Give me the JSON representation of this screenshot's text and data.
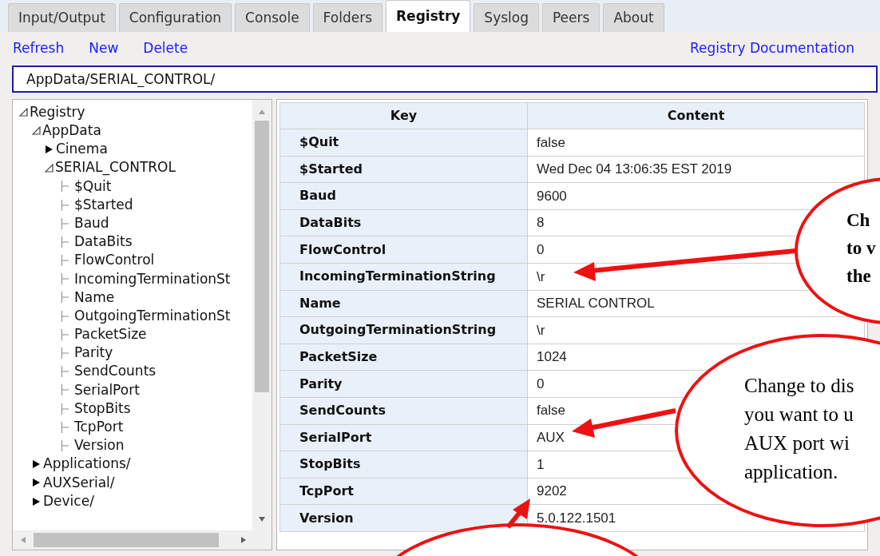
{
  "tabs": [
    {
      "label": "Input/Output",
      "selected": false
    },
    {
      "label": "Configuration",
      "selected": false
    },
    {
      "label": "Console",
      "selected": false
    },
    {
      "label": "Folders",
      "selected": false
    },
    {
      "label": "Registry",
      "selected": true
    },
    {
      "label": "Syslog",
      "selected": false
    },
    {
      "label": "Peers",
      "selected": false
    },
    {
      "label": "About",
      "selected": false
    }
  ],
  "toolbar": {
    "actions": [
      "Refresh",
      "New",
      "Delete"
    ],
    "documentation_link": "Registry Documentation"
  },
  "path_field": {
    "value": "AppData/SERIAL_CONTROL/"
  },
  "tree": [
    {
      "label": "Registry",
      "kind": "folder",
      "expanded": true,
      "children": [
        {
          "label": "AppData",
          "kind": "folder",
          "expanded": true,
          "children": [
            {
              "label": "Cinema",
              "kind": "folder",
              "expanded": false
            },
            {
              "label": "SERIAL_CONTROL",
              "kind": "folder",
              "expanded": true,
              "children": [
                {
                  "label": "$Quit",
                  "kind": "leaf"
                },
                {
                  "label": "$Started",
                  "kind": "leaf"
                },
                {
                  "label": "Baud",
                  "kind": "leaf"
                },
                {
                  "label": "DataBits",
                  "kind": "leaf"
                },
                {
                  "label": "FlowControl",
                  "kind": "leaf"
                },
                {
                  "label": "IncomingTerminationSt",
                  "kind": "leaf"
                },
                {
                  "label": "Name",
                  "kind": "leaf"
                },
                {
                  "label": "OutgoingTerminationSt",
                  "kind": "leaf"
                },
                {
                  "label": "PacketSize",
                  "kind": "leaf"
                },
                {
                  "label": "Parity",
                  "kind": "leaf"
                },
                {
                  "label": "SendCounts",
                  "kind": "leaf"
                },
                {
                  "label": "SerialPort",
                  "kind": "leaf"
                },
                {
                  "label": "StopBits",
                  "kind": "leaf"
                },
                {
                  "label": "TcpPort",
                  "kind": "leaf"
                },
                {
                  "label": "Version",
                  "kind": "leaf"
                }
              ]
            }
          ]
        },
        {
          "label": "Applications/",
          "kind": "folder",
          "expanded": false
        },
        {
          "label": "AUXSerial/",
          "kind": "folder",
          "expanded": false
        },
        {
          "label": "Device/",
          "kind": "folder",
          "expanded": false
        }
      ]
    }
  ],
  "table": {
    "columns": [
      "Key",
      "Content"
    ],
    "rows": [
      [
        "$Quit",
        "false"
      ],
      [
        "$Started",
        "Wed Dec 04 13:06:35 EST 2019"
      ],
      [
        "Baud",
        "9600"
      ],
      [
        "DataBits",
        "8"
      ],
      [
        "FlowControl",
        "0"
      ],
      [
        "IncomingTerminationString",
        "\\r"
      ],
      [
        "Name",
        "SERIAL CONTROL"
      ],
      [
        "OutgoingTerminationString",
        "\\r"
      ],
      [
        "PacketSize",
        "1024"
      ],
      [
        "Parity",
        "0"
      ],
      [
        "SendCounts",
        "false"
      ],
      [
        "SerialPort",
        "AUX"
      ],
      [
        "StopBits",
        "1"
      ],
      [
        "TcpPort",
        "9202"
      ],
      [
        "Version",
        "5.0.122.1501"
      ]
    ]
  },
  "callouts": [
    {
      "bold": true,
      "lines": [
        "Ch",
        "to v",
        "the"
      ]
    },
    {
      "bold": false,
      "lines": [
        "Change to dis",
        "you want to u",
        "AUX port wi",
        "application."
      ]
    }
  ]
}
